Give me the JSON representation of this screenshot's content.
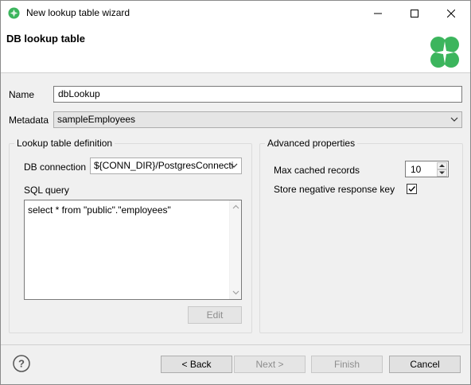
{
  "window": {
    "title": "New lookup table wizard",
    "icon": "clover-icon",
    "controls": [
      "minimize",
      "maximize",
      "close"
    ]
  },
  "header": {
    "title": "DB lookup table",
    "logo": "clover-logo",
    "logo_color": "#3cb55d"
  },
  "form": {
    "name_label": "Name",
    "name_value": "dbLookup",
    "metadata_label": "Metadata",
    "metadata_value": "sampleEmployees"
  },
  "lookup_group": {
    "title": "Lookup table definition",
    "db_connection_label": "DB connection",
    "db_connection_value": "${CONN_DIR}/PostgresConnecti",
    "sql_query_label": "SQL query",
    "sql_query_value": "select * from \"public\".\"employees\"",
    "edit_label": "Edit"
  },
  "advanced_group": {
    "title": "Advanced properties",
    "max_cached_label": "Max cached records",
    "max_cached_value": "10",
    "store_negative_label": "Store negative response key",
    "store_negative_checked": true
  },
  "footer": {
    "back_label": "< Back",
    "next_label": "Next >",
    "finish_label": "Finish",
    "cancel_label": "Cancel",
    "help_icon": "help-icon"
  }
}
